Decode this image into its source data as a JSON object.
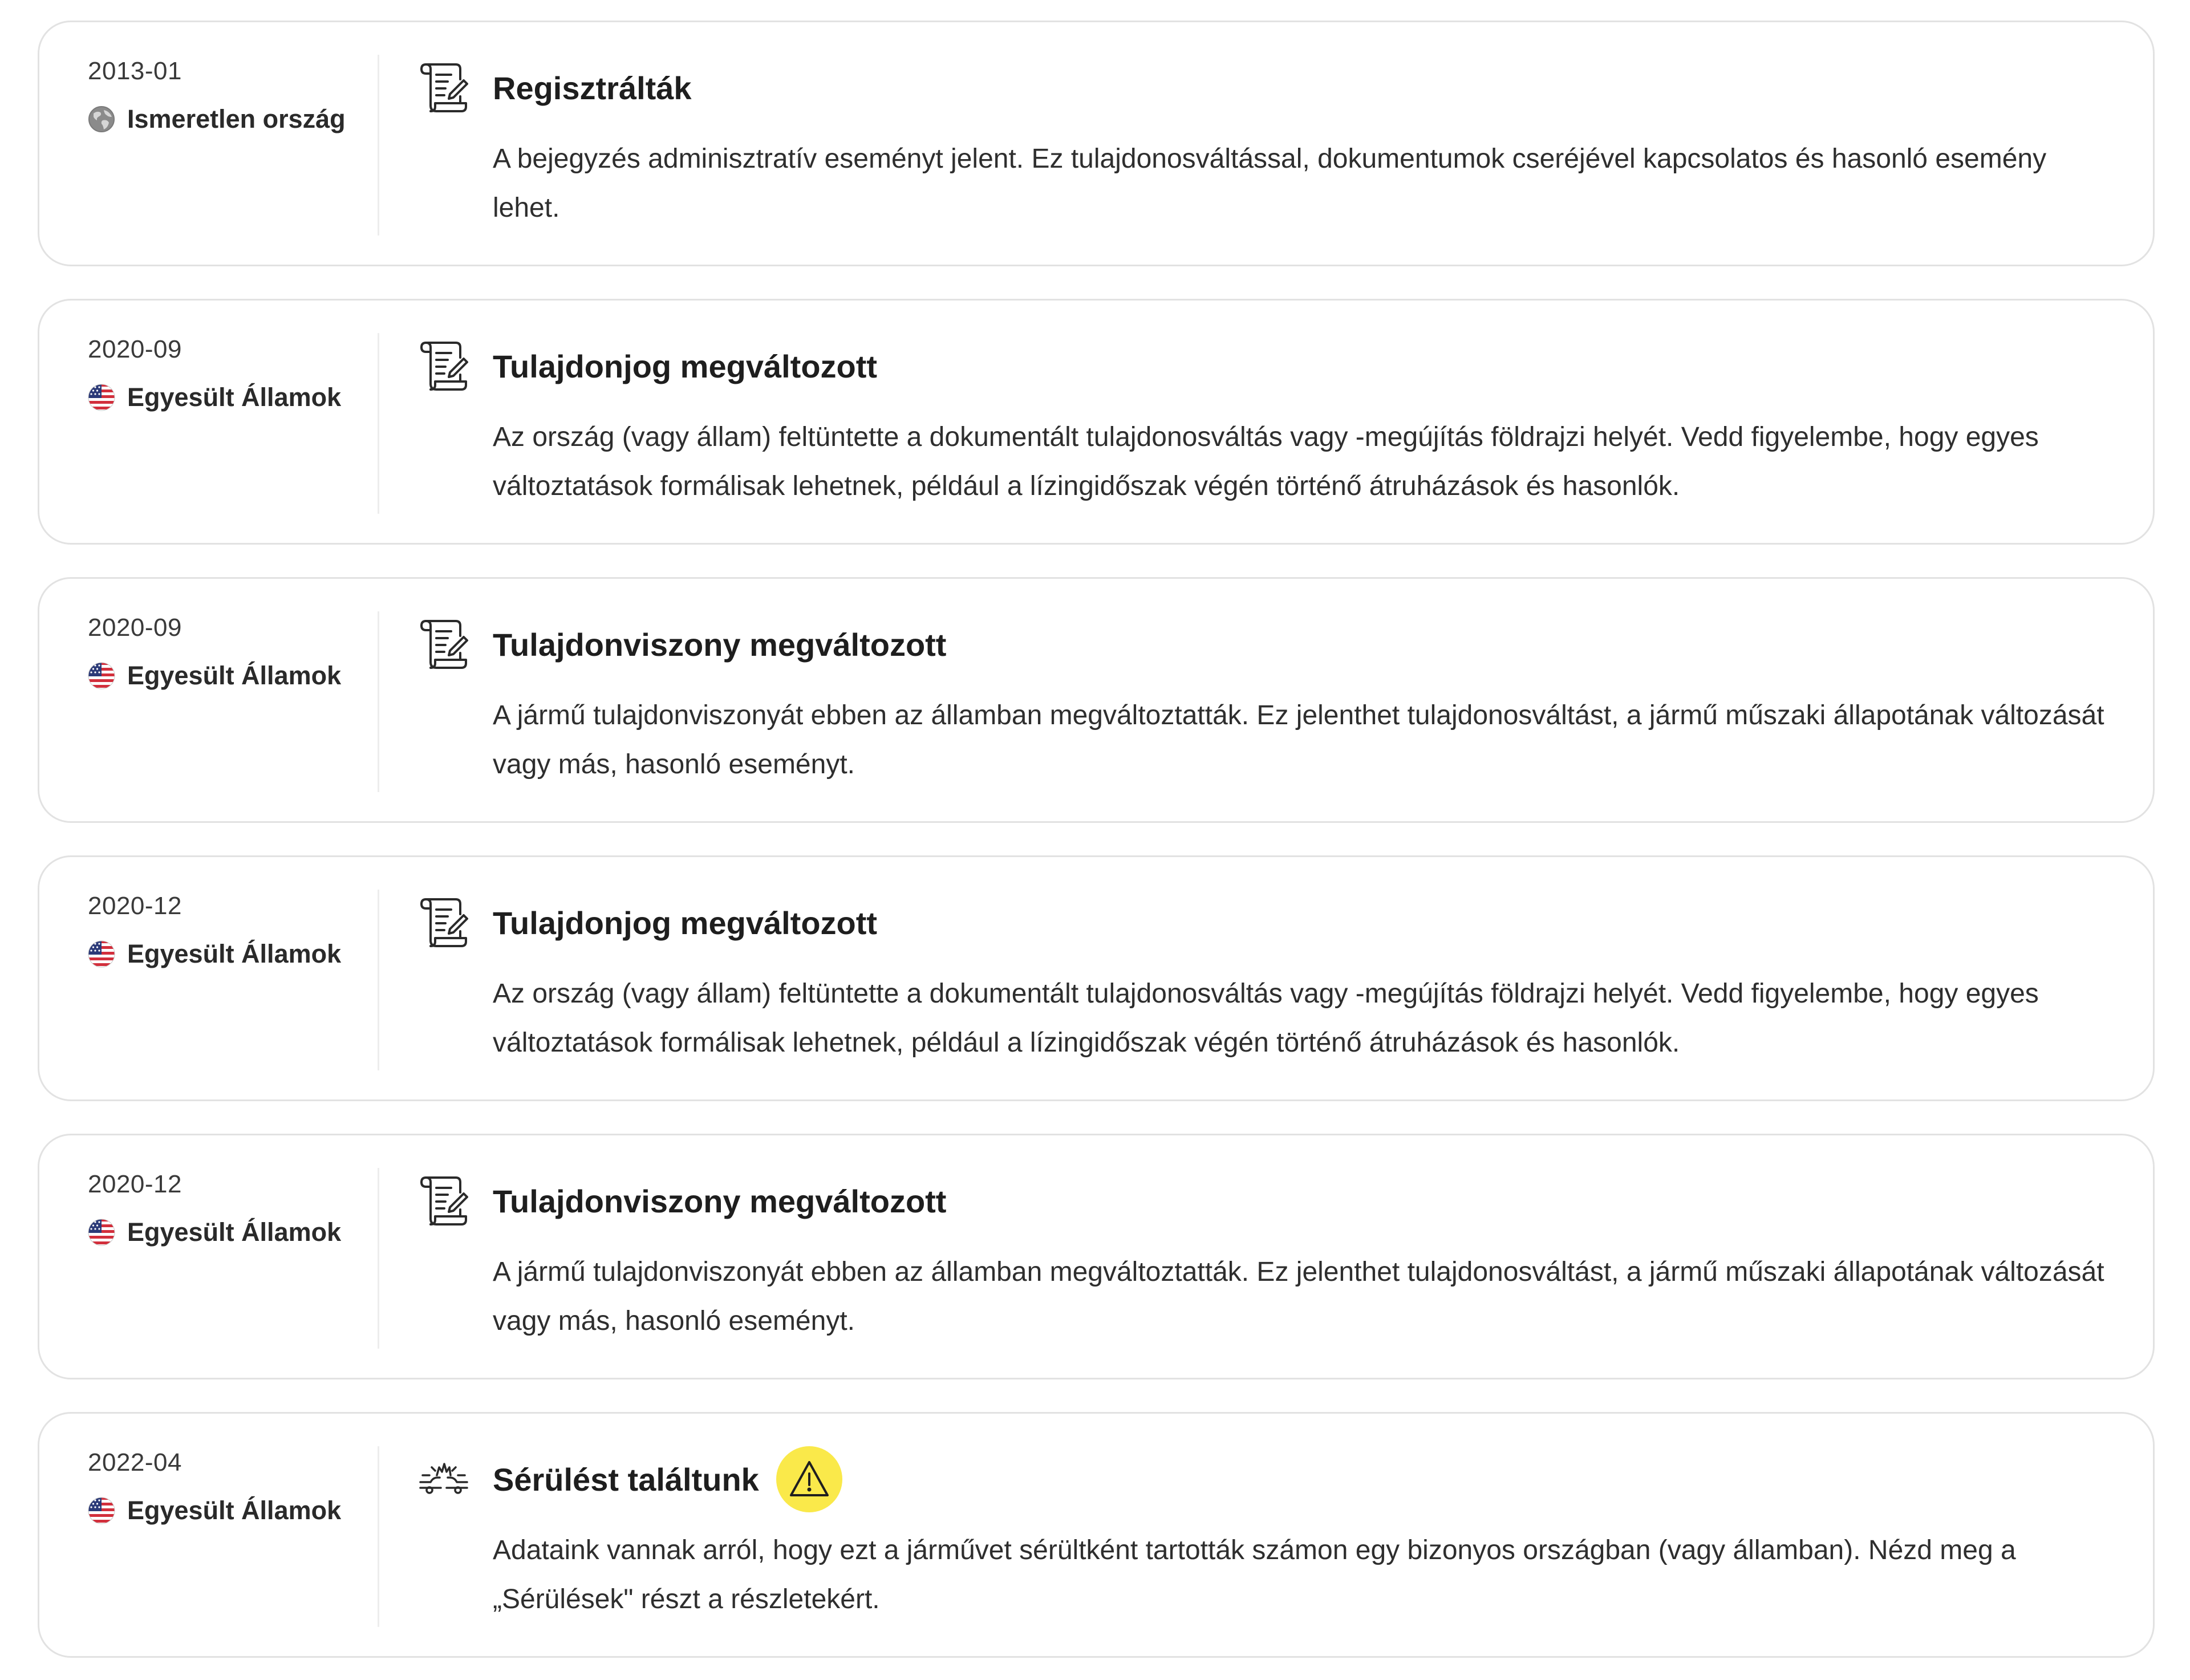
{
  "colors": {
    "card_border": "#e2e2e2",
    "divider": "#ededed",
    "warning_badge": "#fae94a",
    "text_primary": "#1e1e1e"
  },
  "events": [
    {
      "date": "2013-01",
      "country": "Ismeretlen ország",
      "country_icon": "globe-icon",
      "event_icon": "document-icon",
      "title": "Regisztrálták",
      "description": "A bejegyzés adminisztratív eseményt jelent. Ez tulajdonosváltással, dokumentumok cseréjével kapcsolatos és hasonló esemény lehet.",
      "warning": false
    },
    {
      "date": "2020-09",
      "country": "Egyesült Államok",
      "country_icon": "us-flag-icon",
      "event_icon": "document-icon",
      "title": "Tulajdonjog megváltozott",
      "description": "Az ország (vagy állam) feltüntette a dokumentált tulajdonosváltás vagy -megújítás földrajzi helyét. Vedd figyelembe, hogy egyes változtatások formálisak lehetnek, például a lízingidőszak végén történő átruházások és hasonlók.",
      "warning": false
    },
    {
      "date": "2020-09",
      "country": "Egyesült Államok",
      "country_icon": "us-flag-icon",
      "event_icon": "document-icon",
      "title": "Tulajdonviszony megváltozott",
      "description": "A jármű tulajdonviszonyát ebben az államban megváltoztatták. Ez jelenthet tulajdonosváltást, a jármű műszaki állapotának változását vagy más, hasonló eseményt.",
      "warning": false
    },
    {
      "date": "2020-12",
      "country": "Egyesült Államok",
      "country_icon": "us-flag-icon",
      "event_icon": "document-icon",
      "title": "Tulajdonjog megváltozott",
      "description": "Az ország (vagy állam) feltüntette a dokumentált tulajdonosváltás vagy -megújítás földrajzi helyét. Vedd figyelembe, hogy egyes változtatások formálisak lehetnek, például a lízingidőszak végén történő átruházások és hasonlók.",
      "warning": false
    },
    {
      "date": "2020-12",
      "country": "Egyesült Államok",
      "country_icon": "us-flag-icon",
      "event_icon": "document-icon",
      "title": "Tulajdonviszony megváltozott",
      "description": "A jármű tulajdonviszonyát ebben az államban megváltoztatták. Ez jelenthet tulajdonosváltást, a jármű műszaki állapotának változását vagy más, hasonló eseményt.",
      "warning": false
    },
    {
      "date": "2022-04",
      "country": "Egyesült Államok",
      "country_icon": "us-flag-icon",
      "event_icon": "crash-icon",
      "title": "Sérülést találtunk",
      "description": "Adataink vannak arról, hogy ezt a járművet sérültként tartották számon egy bizonyos országban (vagy államban). Nézd meg a „Sérülések\" részt a részletekért.",
      "warning": true,
      "warning_icon": "warning-icon"
    }
  ]
}
